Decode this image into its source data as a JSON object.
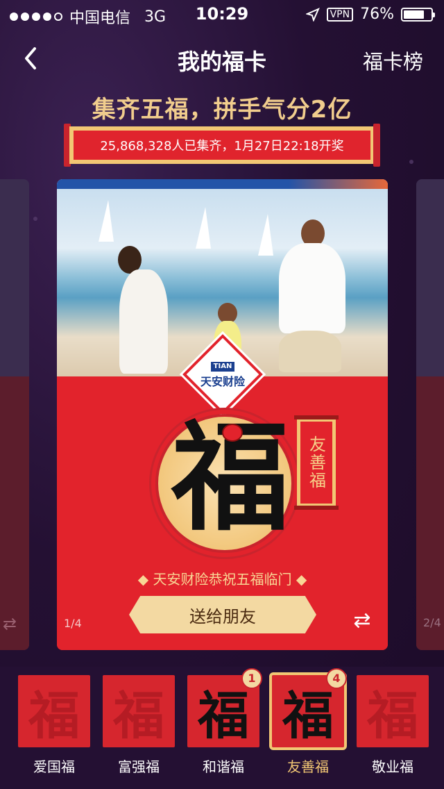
{
  "status_bar": {
    "carrier": "中国电信",
    "network": "3G",
    "time": "10:29",
    "vpn": "VPN",
    "battery": "76%",
    "battery_level": 0.76
  },
  "nav": {
    "title": "我的福卡",
    "right_link": "福卡榜"
  },
  "headline": "集齐五福，拼手气分2亿",
  "banner": "25,868,328人已集齐，1月27日22:18开奖",
  "card": {
    "logo_text": "天安财险",
    "logo_mark": "TIAN",
    "scroll_text": "友善福",
    "greeting": "◆ 天安财险恭祝五福临门 ◆",
    "send_button": "送给朋友",
    "page_indicator": "1/4",
    "fu_glyph": "福"
  },
  "side_cards": {
    "right_page": "2/4"
  },
  "fu_cards": [
    {
      "label": "爱国福",
      "glyph": "福",
      "count": "",
      "active": false,
      "selected": false
    },
    {
      "label": "富强福",
      "glyph": "福",
      "count": "",
      "active": false,
      "selected": false
    },
    {
      "label": "和谐福",
      "glyph": "福",
      "count": "1",
      "active": true,
      "selected": false
    },
    {
      "label": "友善福",
      "glyph": "福",
      "count": "4",
      "active": true,
      "selected": true
    },
    {
      "label": "敬业福",
      "glyph": "福",
      "count": "",
      "active": false,
      "selected": false
    }
  ],
  "colors": {
    "background": "#241033",
    "gold": "#f2c774",
    "red": "#e2232c"
  }
}
